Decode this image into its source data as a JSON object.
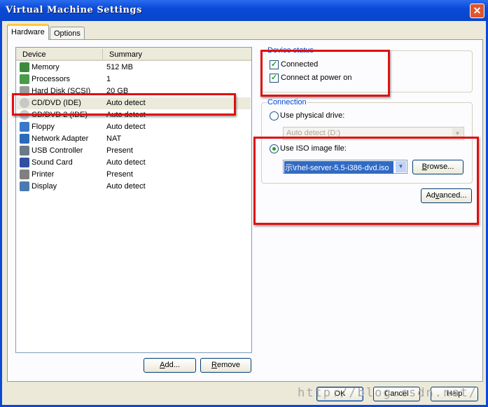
{
  "window": {
    "title": "Virtual Machine Settings",
    "close": "✕"
  },
  "tabs": [
    {
      "label": "Hardware"
    },
    {
      "label": "Options"
    }
  ],
  "list": {
    "headers": [
      "Device",
      "Summary"
    ],
    "rows": [
      {
        "name": "Memory",
        "summary": "512 MB",
        "icon": "memory-icon",
        "color": "#3d8a3d"
      },
      {
        "name": "Processors",
        "summary": "1",
        "icon": "processor-icon",
        "color": "#4a9a4a"
      },
      {
        "name": "Hard Disk (SCSI)",
        "summary": "20 GB",
        "icon": "hard-disk-icon",
        "color": "#9a9a9a"
      },
      {
        "name": "CD/DVD (IDE)",
        "summary": "Auto detect",
        "icon": "cd-icon",
        "color": "#c8c8c8"
      },
      {
        "name": "CD/DVD 2 (IDE)",
        "summary": "Auto detect",
        "icon": "cd-icon",
        "color": "#c8c8c8"
      },
      {
        "name": "Floppy",
        "summary": "Auto detect",
        "icon": "floppy-icon",
        "color": "#3a78c8"
      },
      {
        "name": "Network Adapter",
        "summary": "NAT",
        "icon": "network-icon",
        "color": "#2a6ab8"
      },
      {
        "name": "USB Controller",
        "summary": "Present",
        "icon": "usb-icon",
        "color": "#6a7a8a"
      },
      {
        "name": "Sound Card",
        "summary": "Auto detect",
        "icon": "sound-icon",
        "color": "#3050a0"
      },
      {
        "name": "Printer",
        "summary": "Present",
        "icon": "printer-icon",
        "color": "#808080"
      },
      {
        "name": "Display",
        "summary": "Auto detect",
        "icon": "display-icon",
        "color": "#4a7ab0"
      }
    ],
    "selected_index": 3
  },
  "buttons": {
    "add": "Add...",
    "remove": "Remove",
    "ok": "OK",
    "cancel": "Cancel",
    "help": "Help",
    "browse": "Browse...",
    "advanced": "Advanced..."
  },
  "device_status": {
    "label": "Device status",
    "connected": "Connected",
    "connect_power_on": "Connect at power on",
    "connected_checked": true,
    "power_on_checked": true
  },
  "connection": {
    "label": "Connection",
    "physical_label": "Use physical drive:",
    "physical_value": "Auto detect (D:)",
    "iso_label": "Use ISO image file:",
    "iso_value": "示\\rhel-server-5.5-i386-dvd.iso",
    "selected": "iso"
  },
  "watermark": "http://blog.csdn.net/"
}
